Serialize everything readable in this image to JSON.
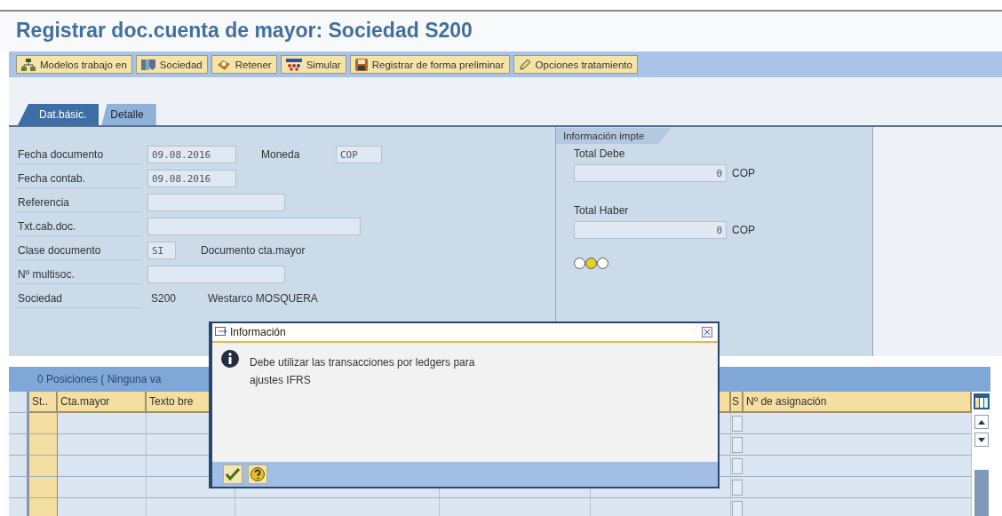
{
  "title": "Registrar doc.cuenta de mayor: Sociedad S200",
  "toolbar": [
    "Modelos trabajo en",
    "Sociedad",
    "Retener",
    "Simular",
    "Registrar de forma preliminar",
    "Opciones tratamiento"
  ],
  "tabs": [
    {
      "label": "Dat.básic.",
      "selected": true
    },
    {
      "label": "Detalle",
      "selected": false
    }
  ],
  "header_fields": [
    {
      "label": "Fecha documento",
      "kind": "date",
      "value": "09.08.2016",
      "side": {
        "label": "Moneda",
        "value": "COP"
      }
    },
    {
      "label": "Fecha contab.",
      "kind": "date",
      "value": "09.08.2016"
    },
    {
      "label": "Referencia",
      "kind": "medium"
    },
    {
      "label": "Txt.cab.doc.",
      "kind": "long"
    },
    {
      "label": "Clase documento",
      "kind": "tiny",
      "value": "SI",
      "description": "Documento cta.mayor"
    },
    {
      "label": "Nº multisoc.",
      "kind": "medium"
    },
    {
      "label": "Sociedad",
      "kind": "display",
      "value": "S200",
      "description": "Westarco MOSQUERA"
    }
  ],
  "amounts": {
    "title": "Información impte",
    "items": [
      {
        "label": "Total Debe",
        "value": "0",
        "currency": "COP"
      },
      {
        "label": "Total Haber",
        "value": "0",
        "currency": "COP"
      }
    ],
    "lights": [
      {
        "on": false
      },
      {
        "on": true
      },
      {
        "on": false
      }
    ]
  },
  "items_table": {
    "title": "0 Posiciones ( Ninguna va",
    "columns": [
      "St..",
      "Cta.mayor",
      "Texto bre",
      "S",
      "Nº de asignación"
    ],
    "rows": [
      {
        "checked": false
      },
      {
        "checked": false
      },
      {
        "checked": false
      },
      {
        "checked": false
      },
      {
        "checked": false
      }
    ]
  },
  "dialog": {
    "title": "Información",
    "message": [
      "Debe utilizar las transacciones por ledgers para",
      "ajustes IFRS"
    ]
  }
}
